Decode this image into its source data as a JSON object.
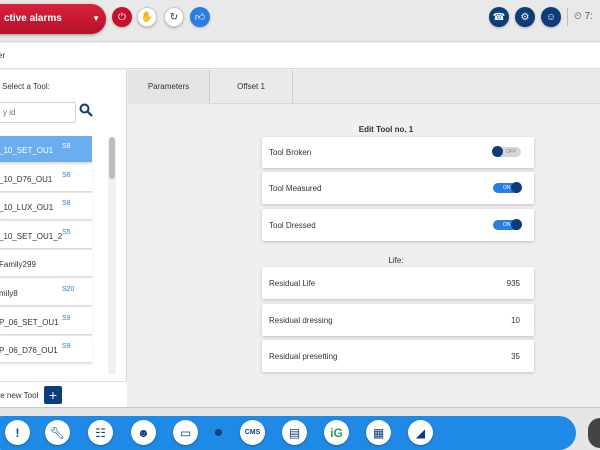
{
  "topbar": {
    "alarm_label": "ctive alarms",
    "clock_text": "7:",
    "icons": [
      "power-icon",
      "hand-icon",
      "refresh-icon",
      "thumbs-up-icon",
      "phone-icon",
      "machine-icon",
      "user-icon",
      "clock-icon"
    ]
  },
  "breadcrumb": {
    "text": "er"
  },
  "sidebar": {
    "select_label": "Select a Tool:",
    "search_placeholder": "y id",
    "tools": [
      {
        "name": "_10_SET_OU1",
        "code": "S8",
        "selected": true
      },
      {
        "name": "_10_D76_OU1",
        "code": "S6"
      },
      {
        "name": "_10_LUX_OU1",
        "code": "S8"
      },
      {
        "name": "_10_SET_OU1_2",
        "code": "S5"
      },
      {
        "name": "Family299",
        "code": ""
      },
      {
        "name": "mily8",
        "code": "S20"
      },
      {
        "name": "P_06_SET_OU1",
        "code": "S9"
      },
      {
        "name": "P_06_D76_OU1",
        "code": "S9"
      }
    ],
    "create_label": "te new Tool",
    "create_button": "+"
  },
  "tabs": [
    {
      "label": "Parameters",
      "active": true
    },
    {
      "label": "Offset 1",
      "active": false
    }
  ],
  "form": {
    "title": "Edit Tool no. 1",
    "toggles": [
      {
        "label": "Tool Broken",
        "state": "OFF"
      },
      {
        "label": "Tool Measured",
        "state": "ON"
      },
      {
        "label": "Tool Dressed",
        "state": "ON"
      }
    ],
    "life_header": "Life:",
    "values": [
      {
        "label": "Residual Life",
        "value": "935"
      },
      {
        "label": "Residual dressing",
        "value": "10"
      },
      {
        "label": "Residual presetting",
        "value": "35"
      }
    ]
  },
  "dock": {
    "icons": [
      "alert-icon",
      "wrench-icon",
      "network-icon",
      "operator-icon",
      "screen-icon",
      "cms-icon",
      "folder-icon",
      "gauge-icon",
      "calculator-icon",
      "chart-icon"
    ]
  },
  "colors": {
    "alarm_red": "#c8102e",
    "brand_blue": "#1f8ae6",
    "navy": "#0d3c7a",
    "selected_row": "#6aaef0"
  }
}
